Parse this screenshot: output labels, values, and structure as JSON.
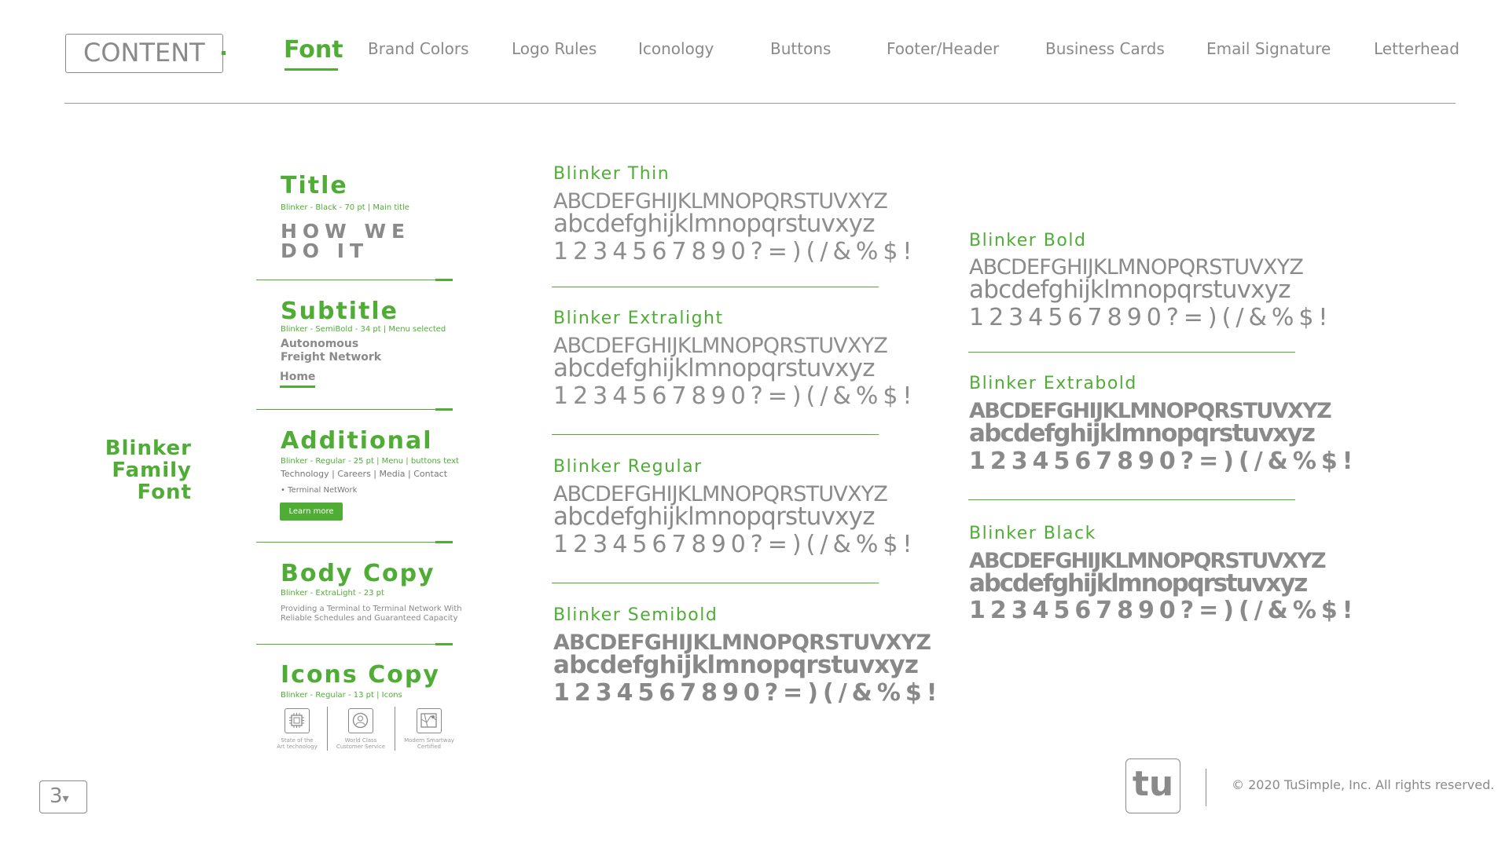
{
  "header": {
    "content_label": "CONTENT",
    "nav": [
      "Font",
      "Brand Colors",
      "Logo Rules",
      "Iconology",
      "Buttons",
      "Footer/Header",
      "Business Cards",
      "Email Signature",
      "Letterhead"
    ],
    "active": "Font"
  },
  "side_heading": [
    "Blinker",
    "Family",
    "Font"
  ],
  "sections": {
    "title": {
      "heading": "Title",
      "spec": "Blinker - Black - 70 pt | Main title",
      "demo": [
        "HOW WE",
        "DO IT"
      ]
    },
    "subtitle": {
      "heading": "Subtitle",
      "spec": "Blinker - SemiBold - 34 pt | Menu selected",
      "demo": [
        "Autonomous",
        "Freight Network"
      ],
      "menu": "Home"
    },
    "additional": {
      "heading": "Additional",
      "spec": "Blinker - Regular - 25 pt | Menu | buttons text",
      "menu_line": "Technology | Careers | Media | Contact",
      "terminal": "Terminal NetWork",
      "button": "Learn more"
    },
    "body_copy": {
      "heading": "Body Copy",
      "spec": "Blinker - ExtraLight - 23 pt",
      "text": [
        "Providing a Terminal to Terminal Network With",
        "Reliable Schedules and Guaranteed Capacity"
      ]
    },
    "icons_copy": {
      "heading": "Icons Copy",
      "spec": "Blinker - Regular - 13 pt  |  Icons",
      "icons": [
        {
          "icon": "chip-icon",
          "caption": [
            "State of the",
            "Art technology"
          ]
        },
        {
          "icon": "person-service-icon",
          "caption": [
            "World Class",
            "Customer Service"
          ]
        },
        {
          "icon": "map-certified-icon",
          "caption": [
            "Modern Smartway",
            "Certified"
          ]
        }
      ]
    }
  },
  "glyphs": {
    "upper": "ABCDEFGHIJKLMNOPQRSTUVXYZ",
    "lower": "abcdefghijklmnopqrstuvxyz",
    "numbers": "1234567890?=)(/&%$!",
    "numbers_alt": "1234567890?=)(/&%$!"
  },
  "specimens": [
    "Blinker Thin",
    "Blinker Extralight",
    "Blinker Regular",
    "Blinker Semibold",
    "Blinker Bold",
    "Blinker Extrabold",
    "Blinker Black"
  ],
  "footer": {
    "page": "3",
    "page_arrow": "▾",
    "logo": "tu",
    "copyright": "© 2020 TuSimple, Inc. All rights reserved."
  },
  "colors": {
    "accent": "#4fad35",
    "text_gray": "#8a8a8a",
    "background": "#ffffff"
  }
}
